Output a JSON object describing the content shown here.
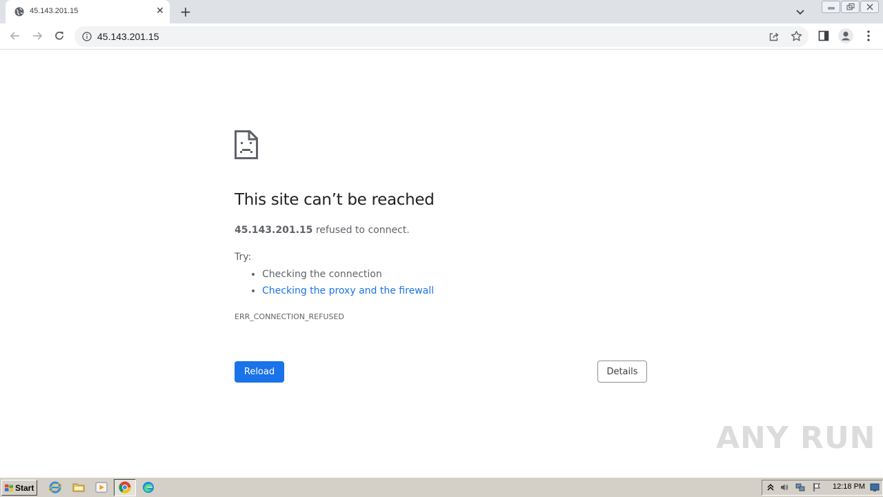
{
  "browser": {
    "tab_title": "45.143.201.15",
    "tab_close": "✕",
    "new_tab": "+",
    "url": "45.143.201.15"
  },
  "error_page": {
    "title": "This site can’t be reached",
    "host": "45.143.201.15",
    "description_suffix": " refused to connect.",
    "try_label": "Try:",
    "suggestions": [
      {
        "text": "Checking the connection",
        "link": false
      },
      {
        "text": "Checking the proxy and the firewall",
        "link": true
      }
    ],
    "error_code": "ERR_CONNECTION_REFUSED",
    "reload_label": "Reload",
    "details_label": "Details"
  },
  "watermark": {
    "text": "ANY RUN"
  },
  "taskbar": {
    "start_label": "Start",
    "clock": "12:18 PM"
  },
  "colors": {
    "primary_button": "#1a73e8",
    "link": "#1a73e8"
  }
}
